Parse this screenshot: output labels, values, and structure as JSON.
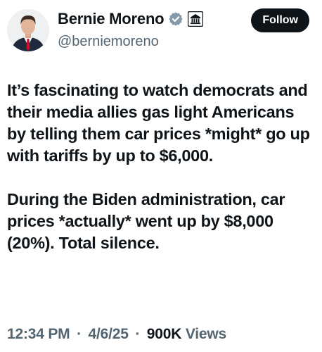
{
  "author": {
    "display_name": "Bernie Moreno",
    "handle": "@berniemoreno",
    "verified_badge_icon": "verified-badge-icon",
    "affiliation_icon": "government-building-icon",
    "badge_color": "#829aab"
  },
  "actions": {
    "follow_label": "Follow"
  },
  "tweet": {
    "paragraphs": [
      "It’s fascinating to watch democrats and their media allies gas light Americans by telling them car prices *might* go up with tariffs by up to $6,000.",
      "During the Biden administration, car prices *actually* went up by $8,000 (20%). Total silence."
    ]
  },
  "meta": {
    "time": "12:34 PM",
    "separator": "·",
    "date": "4/6/25",
    "views_count": "900K",
    "views_label": "Views"
  }
}
